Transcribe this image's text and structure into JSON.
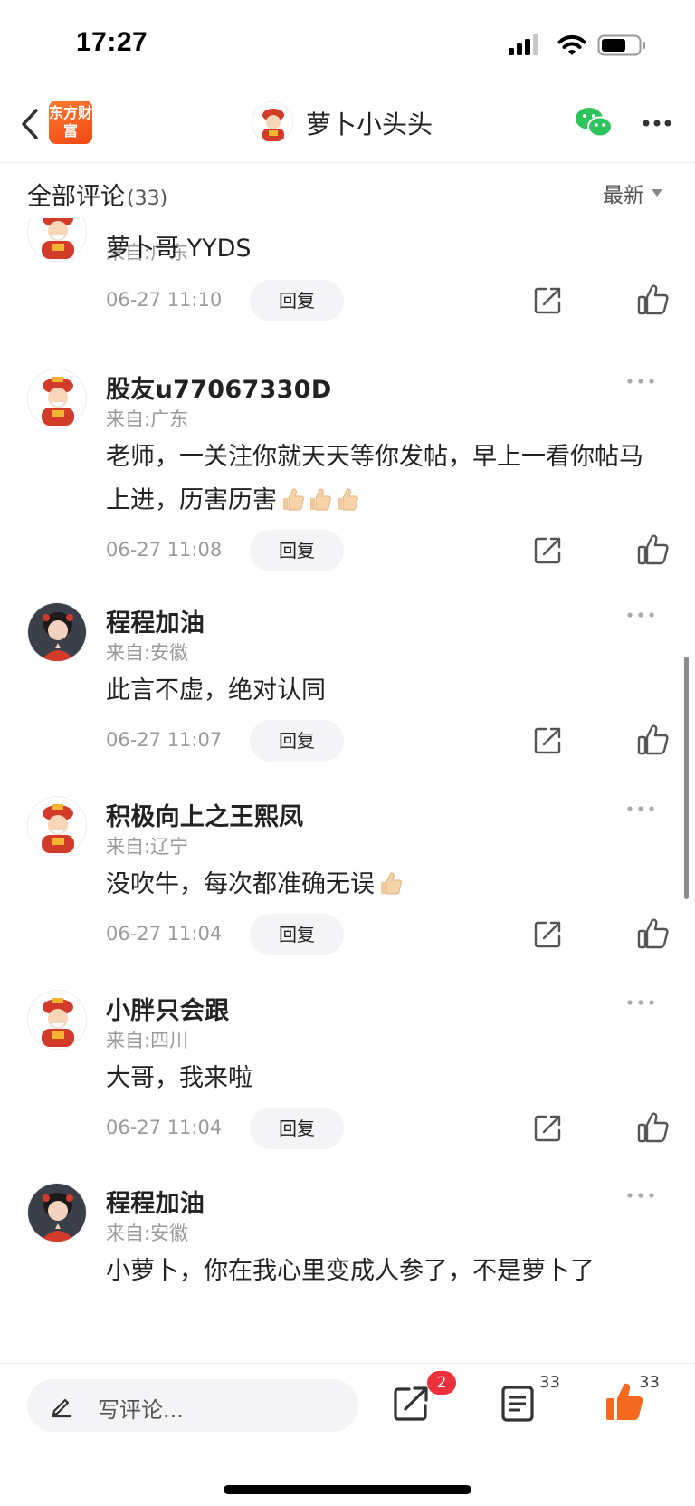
{
  "status_bar": {
    "time": "17:27"
  },
  "nav": {
    "app_logo": "东方财富",
    "title": "萝卜小头头"
  },
  "header": {
    "title": "全部评论",
    "count": "(33)",
    "sort_label": "最新"
  },
  "comments": [
    {
      "username": "",
      "location": "来自:广东",
      "content": "萝卜哥 YYDS",
      "time": "06-27 11:10",
      "reply_label": "回复",
      "thumbs": 0
    },
    {
      "username": "股友u77067330D",
      "location": "来自:广东",
      "content": "老师，一关注你就天天等你发帖，早上一看你帖马上进，历害历害",
      "time": "06-27 11:08",
      "reply_label": "回复",
      "thumbs": 3
    },
    {
      "username": "程程加油",
      "location": "来自:安徽",
      "content": "此言不虚，绝对认同",
      "time": "06-27 11:07",
      "reply_label": "回复",
      "thumbs": 0
    },
    {
      "username": "积极向上之王熙凤",
      "location": "来自:辽宁",
      "content": "没吹牛，每次都准确无误",
      "time": "06-27 11:04",
      "reply_label": "回复",
      "thumbs": 1
    },
    {
      "username": "小胖只会跟",
      "location": "来自:四川",
      "content": "大哥，我来啦",
      "time": "06-27 11:04",
      "reply_label": "回复",
      "thumbs": 0
    },
    {
      "username": "程程加油",
      "location": "来自:安徽",
      "content": "小萝卜，你在我心里变成人参了，不是萝卜了",
      "time": "",
      "reply_label": "",
      "thumbs": 0
    }
  ],
  "bottom_bar": {
    "input_placeholder": "写评论...",
    "share_badge": "2",
    "comments_count": "33",
    "likes_count": "33"
  },
  "colors": {
    "accent": "#f4691e",
    "badge": "#ee2f3c",
    "wechat": "#2ec45c"
  },
  "icons": [
    "back-icon",
    "wechat-icon",
    "more-icon",
    "share-icon",
    "like-icon",
    "pencil-icon",
    "comments-icon",
    "thumbs-up-emoji"
  ]
}
